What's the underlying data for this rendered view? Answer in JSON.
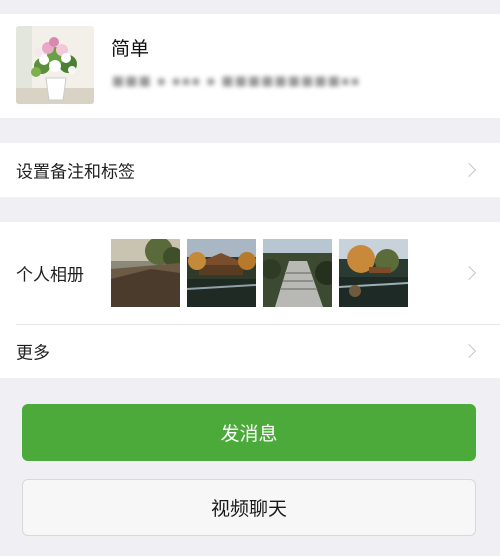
{
  "profile": {
    "name": "简单",
    "wechat_id_blurred": "■■■ ▪ ▪▪▪ ▪ ■■■■■■■■■▪▪"
  },
  "remark_row": {
    "label": "设置备注和标签"
  },
  "album_row": {
    "label": "个人相册",
    "photo_count": 4
  },
  "more_row": {
    "label": "更多"
  },
  "buttons": {
    "send_message": "发消息",
    "video_chat": "视频聊天"
  },
  "colors": {
    "primary": "#4caa3a",
    "background": "#efeff4",
    "chevron": "#c7c7cc"
  }
}
